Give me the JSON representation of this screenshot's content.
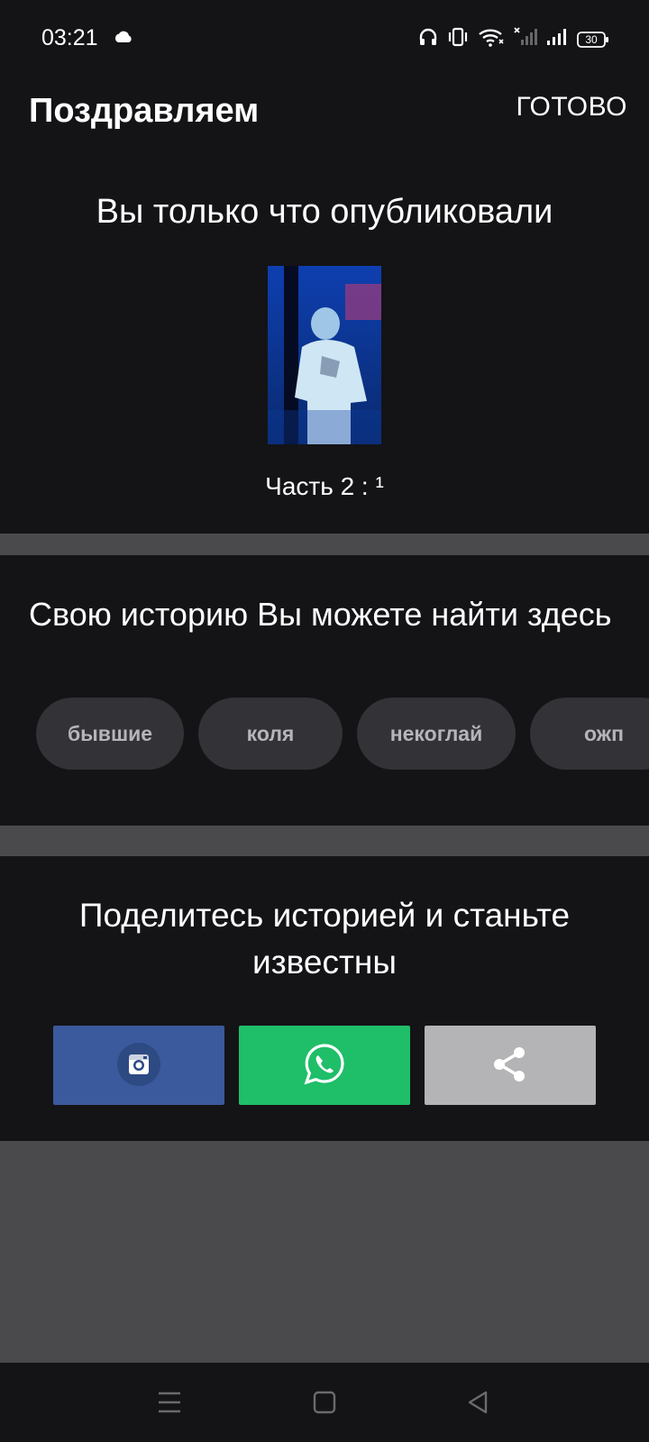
{
  "status_bar": {
    "time": "03:21",
    "battery": "30",
    "icons": [
      "cloud-icon",
      "headphones-icon",
      "vibrate-icon",
      "wifi-icon",
      "signal-no-service-icon",
      "signal-icon",
      "battery-icon"
    ]
  },
  "header": {
    "title": "Поздравляем",
    "done_label": "ГОТОВО"
  },
  "published": {
    "title": "Вы только что опубликовали",
    "part_label": "Часть 2 : ¹"
  },
  "story": {
    "title": "Свою историю Вы можете найти здесь",
    "tags": [
      {
        "label": "бывшие"
      },
      {
        "label": "коля"
      },
      {
        "label": "некоглай"
      },
      {
        "label": "ожп"
      }
    ]
  },
  "share": {
    "title": "Поделитесь историей и станьте известны",
    "buttons": [
      {
        "icon": "instagram-icon",
        "color": "#3b5a9d"
      },
      {
        "icon": "whatsapp-icon",
        "color": "#1fbe69"
      },
      {
        "icon": "share-icon",
        "color": "#b4b4b6"
      }
    ]
  },
  "nav_bar": {
    "icons": [
      "menu-icon",
      "home-square-icon",
      "back-triangle-icon"
    ]
  },
  "colors": {
    "background": "#141316",
    "divider": "#4a494c",
    "tag_bg": "#333236"
  }
}
